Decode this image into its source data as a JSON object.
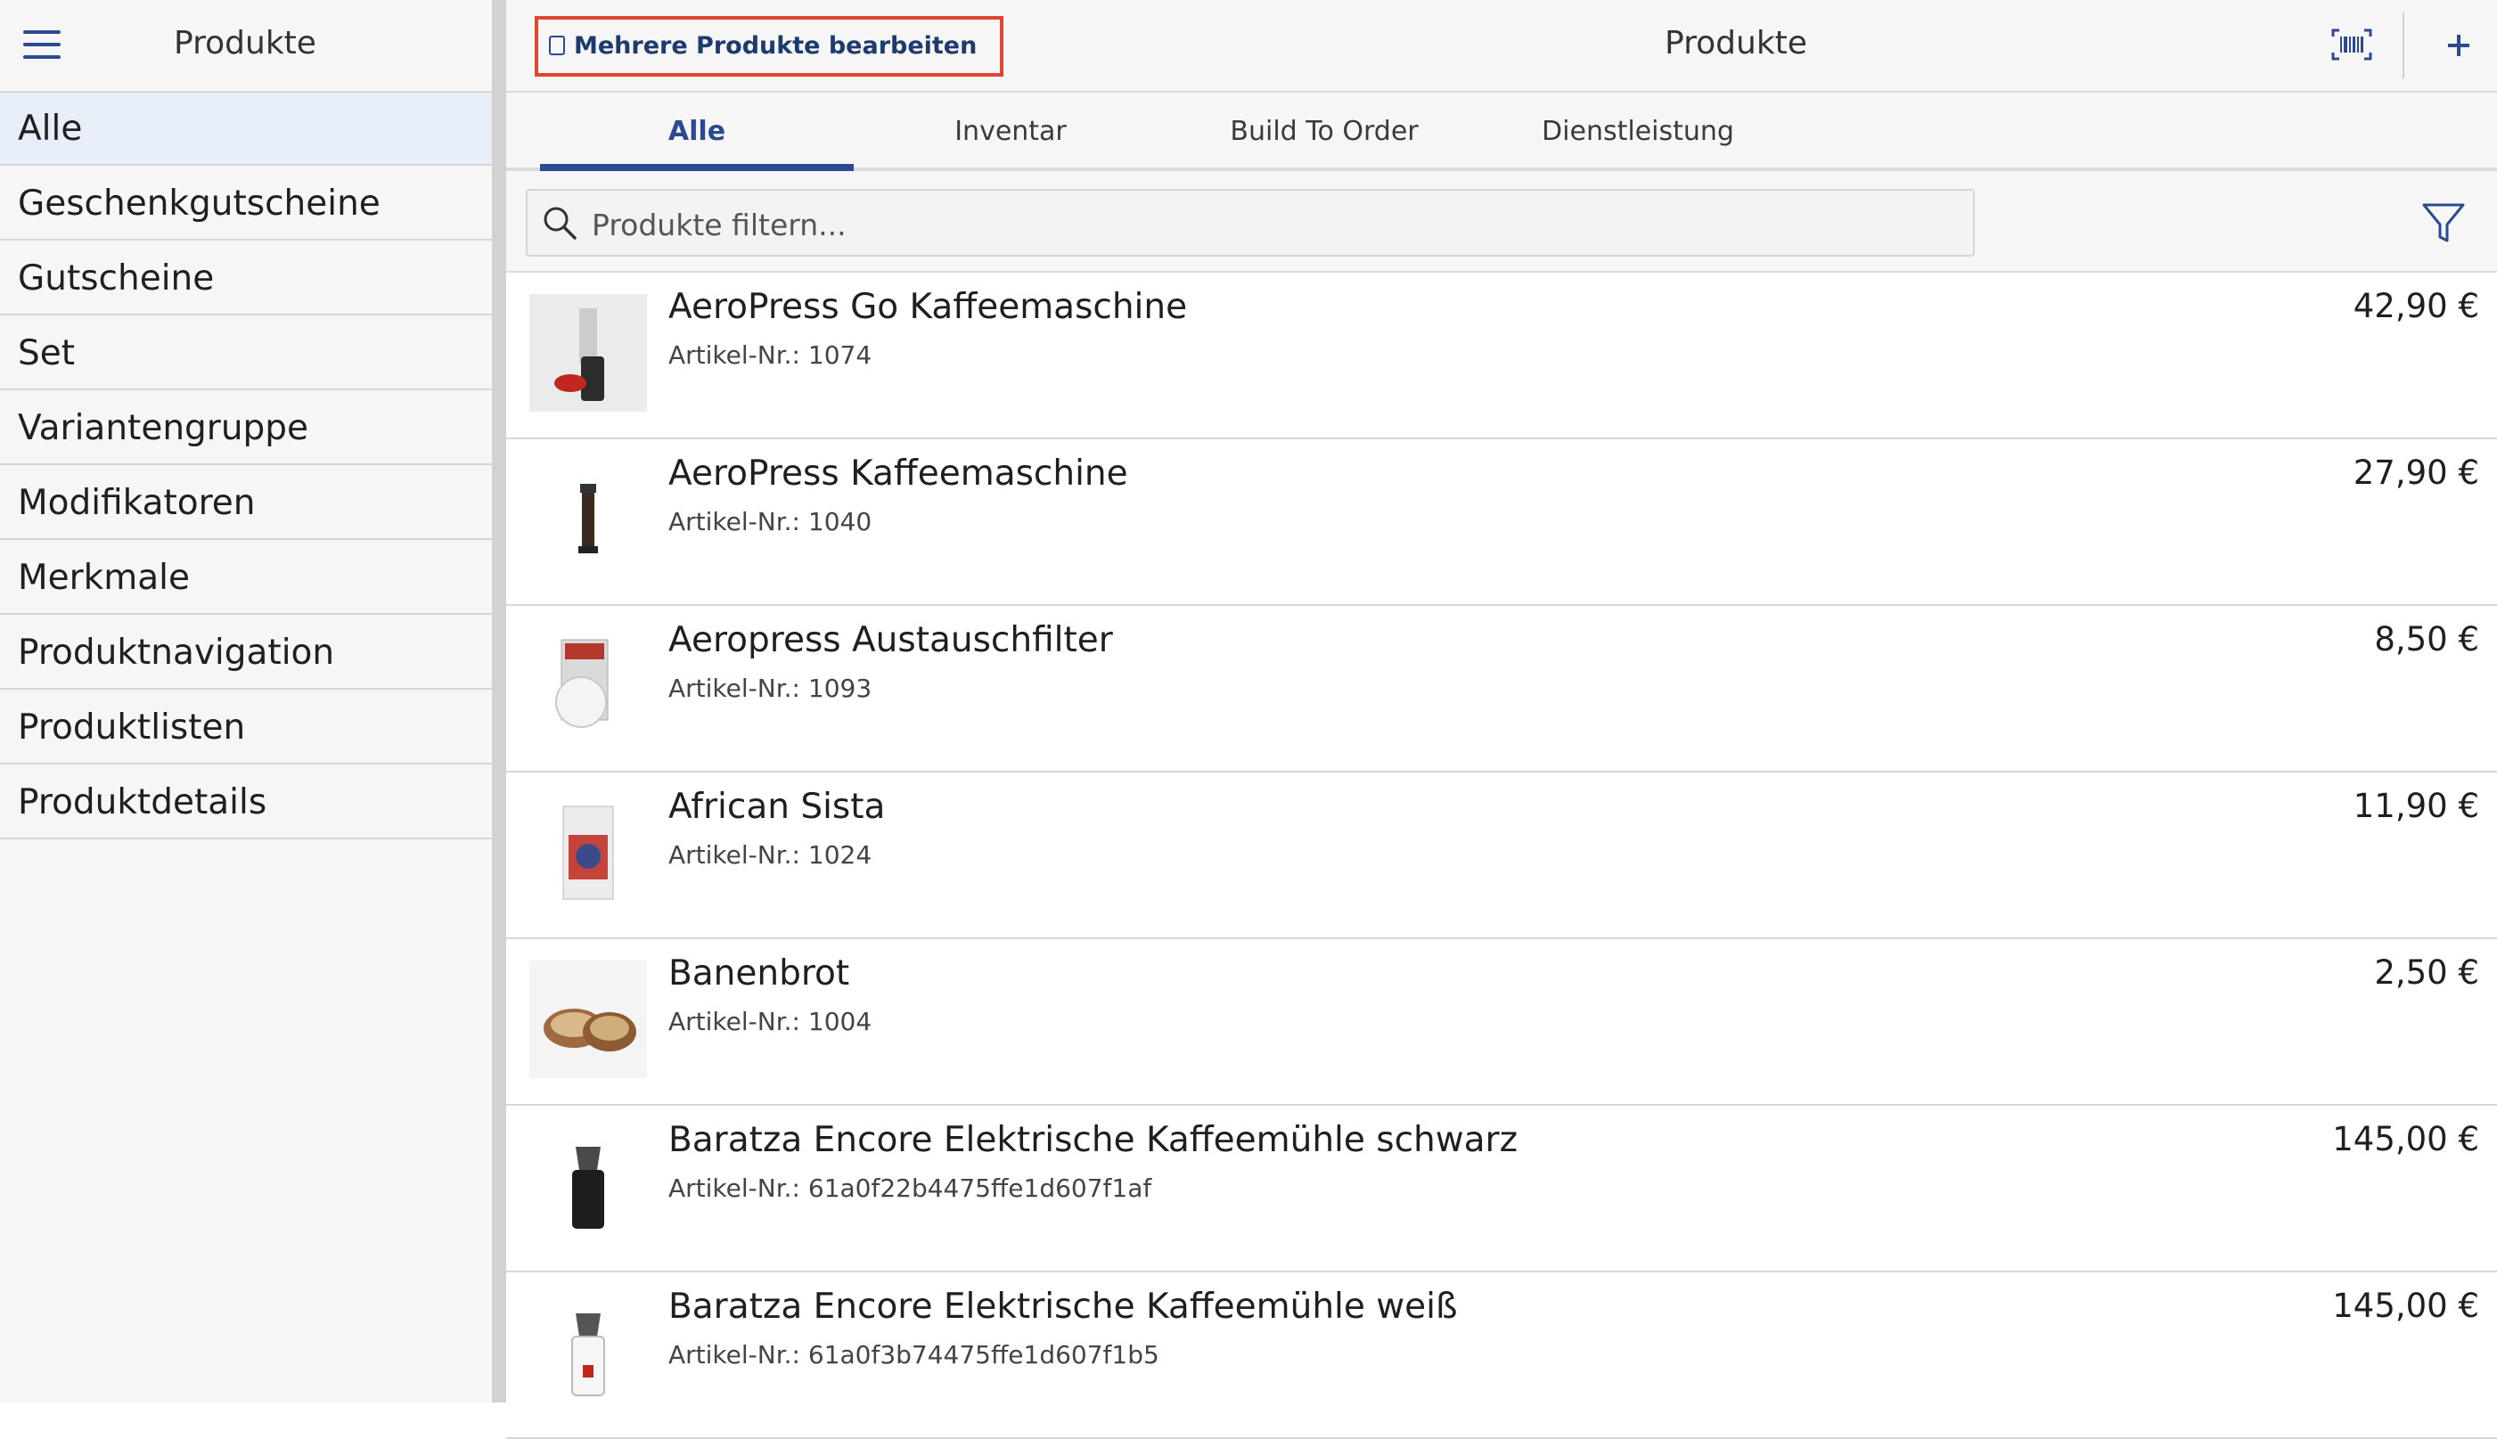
{
  "sidebar": {
    "title": "Produkte",
    "categories": [
      "Alle",
      "Geschenkgutscheine",
      "Gutscheine",
      "Set",
      "Variantengruppe",
      "Modifikatoren",
      "Merkmale",
      "Produktnavigation",
      "Produktlisten",
      "Produktdetails"
    ],
    "active_index": 0
  },
  "header": {
    "bulk_edit_label": "Mehrere Produkte bearbeiten",
    "title": "Produkte"
  },
  "tabs": [
    "Alle",
    "Inventar",
    "Build To Order",
    "Dienstleistung"
  ],
  "active_tab": 0,
  "search": {
    "placeholder": "Produkte filtern..."
  },
  "sku_prefix": "Artikel-Nr.: ",
  "products": [
    {
      "name": "AeroPress Go Kaffeemaschine",
      "sku": "1074",
      "price": "42,90 €"
    },
    {
      "name": "AeroPress Kaffeemaschine",
      "sku": "1040",
      "price": "27,90 €"
    },
    {
      "name": "Aeropress Austauschfilter",
      "sku": "1093",
      "price": "8,50 €"
    },
    {
      "name": "African Sista",
      "sku": "1024",
      "price": "11,90 €"
    },
    {
      "name": "Banenbrot",
      "sku": "1004",
      "price": "2,50 €"
    },
    {
      "name": "Baratza Encore Elektrische Kaffeemühle schwarz",
      "sku": "61a0f22b4475ffe1d607f1af",
      "price": "145,00 €"
    },
    {
      "name": "Baratza Encore Elektrische Kaffeemühle weiß",
      "sku": "61a0f3b74475ffe1d607f1b5",
      "price": "145,00 €"
    }
  ],
  "colors": {
    "accent": "#2b4a8f",
    "highlight_border": "#e0452f",
    "active_bg": "#e8eef8"
  }
}
